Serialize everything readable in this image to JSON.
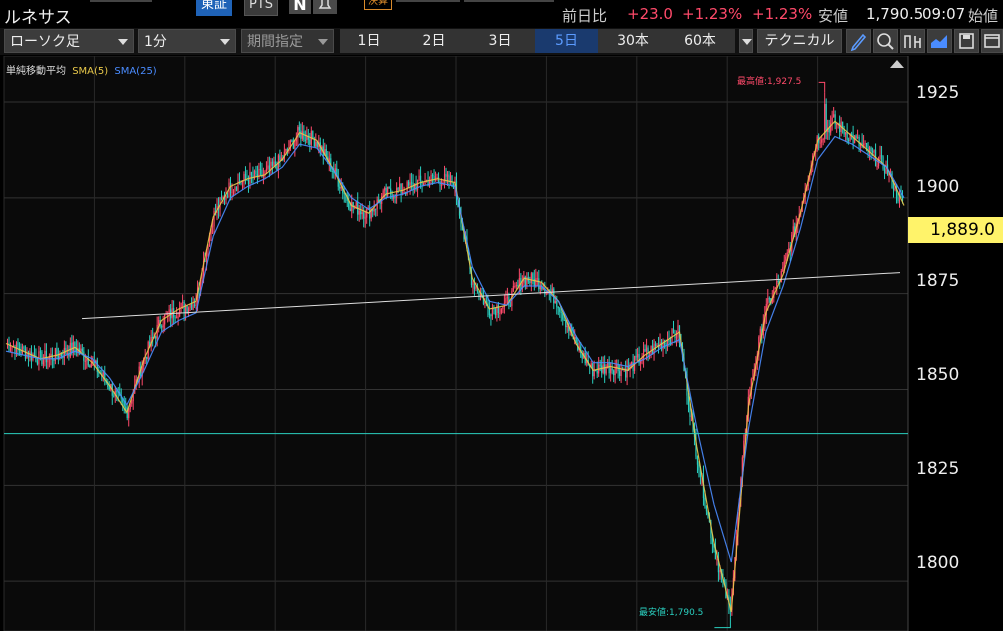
{
  "header": {
    "stock_name": "ルネサス",
    "exchange_label": "東証",
    "pts_label": "PTS",
    "n_icon_label": "N",
    "earnings_badge": "決算",
    "change_label": "前日比",
    "change_value": "+23.0",
    "change_pct": "+1.23%",
    "change_pct2": "+1.23%",
    "low_label": "安値",
    "low_value": "1,790.5",
    "time": "09:07",
    "open_label": "始値"
  },
  "toolbar": {
    "chart_type": "ローソク足",
    "interval": "1分",
    "period_select": "期間指定",
    "periods": [
      "1日",
      "2日",
      "3日",
      "5日",
      "30本",
      "60本"
    ],
    "active_period": "5日",
    "technical": "テクニカル",
    "icons": [
      "pen-icon",
      "zoom-icon",
      "export-icon",
      "area-chart-icon",
      "save-icon",
      "window-icon"
    ]
  },
  "chart": {
    "legend": {
      "title": "単純移動平均",
      "sma5": "SMA(5)",
      "sma25": "SMA(25)"
    },
    "colors": {
      "sma5": "#e8c84a",
      "sma25": "#4a8cff",
      "up": "#ff4a6a",
      "down": "#2ad0c0",
      "hline": "#2ad0c0",
      "tag": "#fff36a"
    },
    "high_label": "最高値:1,927.5",
    "low_label": "最安値:1,790.5",
    "current_price": "1,889.0",
    "y_ticks": [
      "1925",
      "1900",
      "1875",
      "1850",
      "1825",
      "1800"
    ]
  },
  "chart_data": {
    "type": "line",
    "series": [
      {
        "name": "SMA(5)",
        "values": [
          1862,
          1860,
          1858,
          1859,
          1861,
          1857,
          1851,
          1844,
          1858,
          1868,
          1871,
          1873,
          1895,
          1903,
          1905,
          1906,
          1910,
          1917,
          1915,
          1907,
          1898,
          1896,
          1901,
          1902,
          1904,
          1905,
          1904,
          1879,
          1871,
          1872,
          1879,
          1878,
          1873,
          1862,
          1855,
          1856,
          1855,
          1859,
          1862,
          1865,
          1835,
          1810,
          1792,
          1846,
          1870,
          1880,
          1896,
          1915,
          1920,
          1916,
          1912,
          1908,
          1898
        ]
      },
      {
        "name": "SMA(25)",
        "values": [
          1860,
          1859,
          1858,
          1858,
          1860,
          1858,
          1853,
          1846,
          1855,
          1865,
          1868,
          1870,
          1890,
          1900,
          1903,
          1905,
          1908,
          1914,
          1913,
          1907,
          1900,
          1897,
          1900,
          1901,
          1903,
          1904,
          1903,
          1882,
          1873,
          1872,
          1877,
          1877,
          1873,
          1864,
          1857,
          1857,
          1856,
          1858,
          1861,
          1863,
          1840,
          1820,
          1805,
          1840,
          1865,
          1877,
          1892,
          1910,
          1916,
          1914,
          1911,
          1908,
          1900
        ]
      }
    ],
    "ylim": [
      1787,
      1937
    ],
    "high": 1927.5,
    "low": 1790.5,
    "current": 1889.0,
    "support_line": 1838.5,
    "trend_line": [
      1868.5,
      1880.5
    ]
  }
}
